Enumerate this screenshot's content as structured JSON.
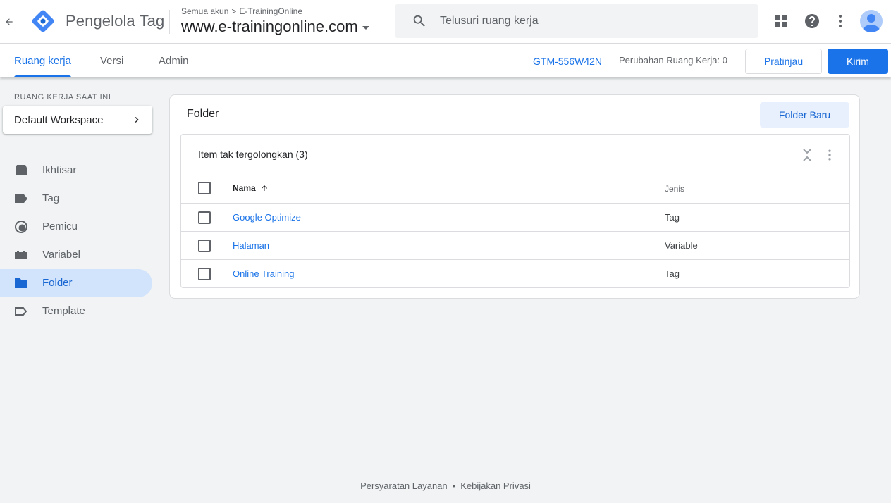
{
  "header": {
    "product_name": "Pengelola Tag",
    "breadcrumb": {
      "all_accounts": "Semua akun",
      "separator": ">",
      "account": "E-TrainingOnline"
    },
    "container_name": "www.e-trainingonline.com",
    "search_placeholder": "Telusuri ruang kerja",
    "icons": [
      "back-arrow-icon",
      "gtm-logo-icon",
      "chevron-down-icon",
      "search-icon",
      "apps-grid-icon",
      "help-icon",
      "more-vert-icon",
      "account-avatar-icon"
    ]
  },
  "nav": {
    "tabs": [
      {
        "label": "Ruang kerja",
        "active": true
      },
      {
        "label": "Versi",
        "active": false
      },
      {
        "label": "Admin",
        "active": false
      }
    ],
    "container_id": "GTM-556W42N",
    "workspace_changes": "Perubahan Ruang Kerja: 0",
    "preview_label": "Pratinjau",
    "submit_label": "Kirim"
  },
  "sidebar": {
    "current_workspace_label": "RUANG KERJA SAAT INI",
    "workspace_name": "Default Workspace",
    "items": [
      {
        "label": "Ikhtisar",
        "icon": "overview-icon",
        "active": false
      },
      {
        "label": "Tag",
        "icon": "tag-icon",
        "active": false
      },
      {
        "label": "Pemicu",
        "icon": "trigger-icon",
        "active": false
      },
      {
        "label": "Variabel",
        "icon": "variable-icon",
        "active": false
      },
      {
        "label": "Folder",
        "icon": "folder-icon",
        "active": true
      },
      {
        "label": "Template",
        "icon": "template-icon",
        "active": false
      }
    ]
  },
  "main": {
    "title": "Folder",
    "new_folder_label": "Folder Baru",
    "folder": {
      "name": "Item tak tergolongkan (3)",
      "columns": {
        "name": "Nama",
        "type": "Jenis"
      },
      "rows": [
        {
          "name": "Google Optimize",
          "type": "Tag"
        },
        {
          "name": "Halaman",
          "type": "Variable"
        },
        {
          "name": "Online Training",
          "type": "Tag"
        }
      ]
    }
  },
  "footer": {
    "terms": "Persyaratan Layanan",
    "dot": "•",
    "privacy": "Kebijakan Privasi"
  },
  "colors": {
    "accent": "#1a73e8",
    "active_nav_bg": "#d2e3fc",
    "page_bg": "#f1f3f4"
  }
}
